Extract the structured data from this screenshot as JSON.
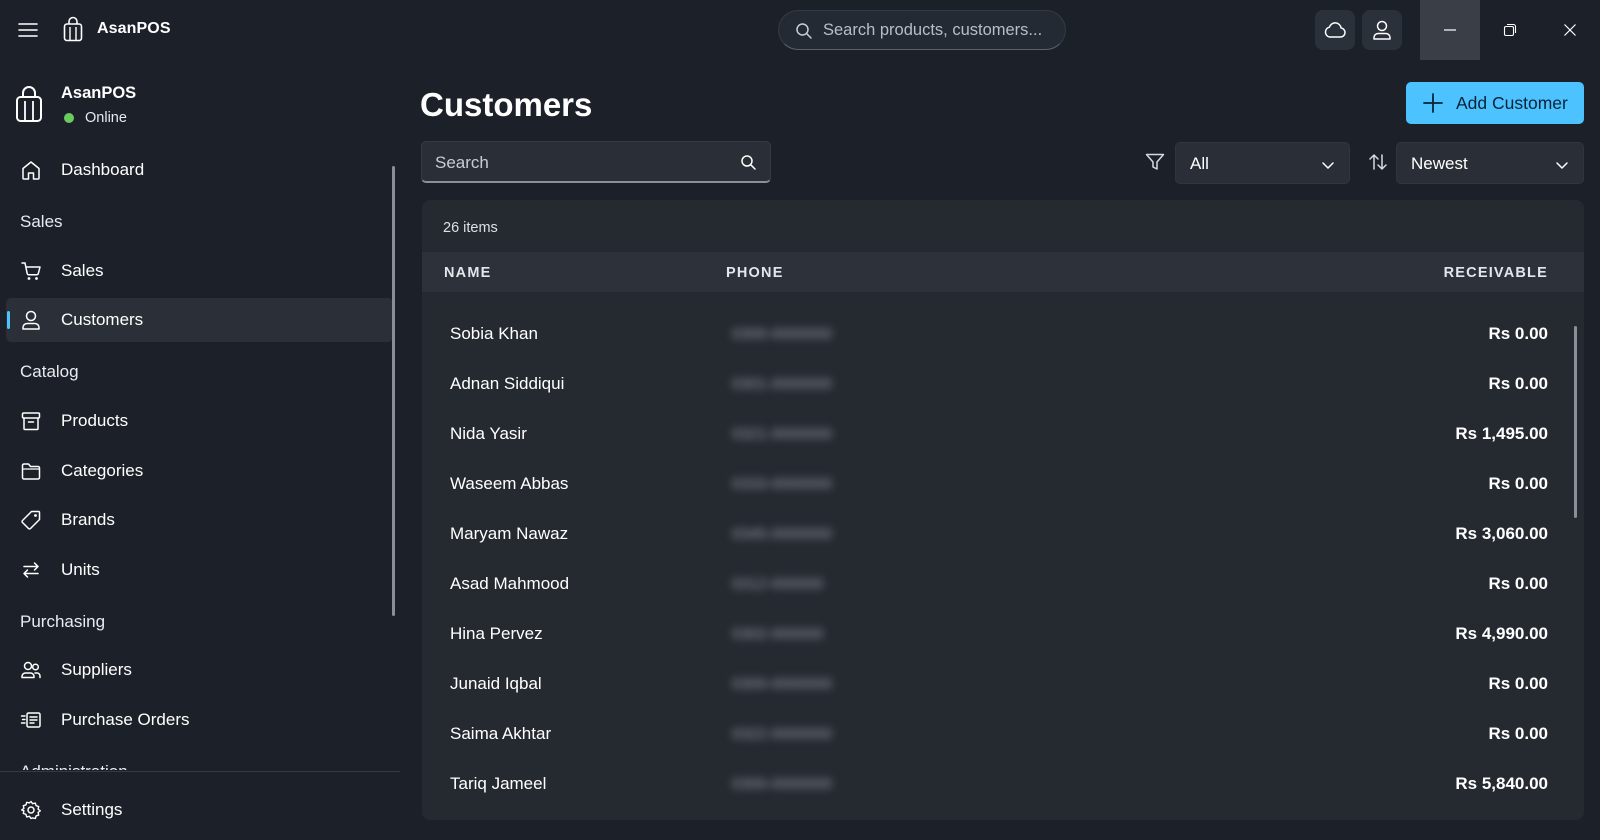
{
  "app": {
    "name": "AsanPOS",
    "search_placeholder": "Search products, customers..."
  },
  "sidebar": {
    "title": "AsanPOS",
    "status": "Online",
    "status_color": "#6ccb5f",
    "items": [
      {
        "type": "item",
        "label": "Dashboard",
        "icon": "home-icon"
      },
      {
        "type": "header",
        "label": "Sales"
      },
      {
        "type": "item",
        "label": "Sales",
        "icon": "cart-icon"
      },
      {
        "type": "item",
        "label": "Customers",
        "icon": "person-icon",
        "active": true
      },
      {
        "type": "header",
        "label": "Catalog"
      },
      {
        "type": "item",
        "label": "Products",
        "icon": "archive-box-icon"
      },
      {
        "type": "item",
        "label": "Categories",
        "icon": "folder-icon"
      },
      {
        "type": "item",
        "label": "Brands",
        "icon": "tag-icon"
      },
      {
        "type": "item",
        "label": "Units",
        "icon": "swap-arrows-icon"
      },
      {
        "type": "header",
        "label": "Purchasing"
      },
      {
        "type": "item",
        "label": "Suppliers",
        "icon": "people-icon"
      },
      {
        "type": "item",
        "label": "Purchase Orders",
        "icon": "receipt-icon"
      }
    ],
    "clipped_header": "Administration",
    "footer": {
      "label": "Settings",
      "icon": "gear-icon"
    }
  },
  "main": {
    "title": "Customers",
    "add_button_label": "Add Customer",
    "accent_color": "#4cc2ff",
    "search_placeholder": "Search",
    "filter_value": "All",
    "sort_value": "Newest",
    "items_count": "26 items",
    "columns": {
      "name": "NAME",
      "phone": "PHONE",
      "receivable": "RECEIVABLE"
    },
    "rows": [
      {
        "name": "Sobia Khan",
        "phone": "0300-0000000",
        "receivable": "Rs 0.00"
      },
      {
        "name": "Adnan Siddiqui",
        "phone": "0301-0000000",
        "receivable": "Rs 0.00"
      },
      {
        "name": "Nida Yasir",
        "phone": "0321-0000000",
        "receivable": "Rs 1,495.00"
      },
      {
        "name": "Waseem Abbas",
        "phone": "0333-0000000",
        "receivable": "Rs 0.00"
      },
      {
        "name": "Maryam Nawaz",
        "phone": "0345-0000000",
        "receivable": "Rs 3,060.00"
      },
      {
        "name": "Asad Mahmood",
        "phone": "0312-000000",
        "receivable": "Rs 0.00"
      },
      {
        "name": "Hina Pervez",
        "phone": "0302-000000",
        "receivable": "Rs 4,990.00"
      },
      {
        "name": "Junaid Iqbal",
        "phone": "0300-0000000",
        "receivable": "Rs 0.00"
      },
      {
        "name": "Saima Akhtar",
        "phone": "0322-0000000",
        "receivable": "Rs 0.00"
      },
      {
        "name": "Tariq Jameel",
        "phone": "0300-0000000",
        "receivable": "Rs 5,840.00"
      }
    ]
  }
}
